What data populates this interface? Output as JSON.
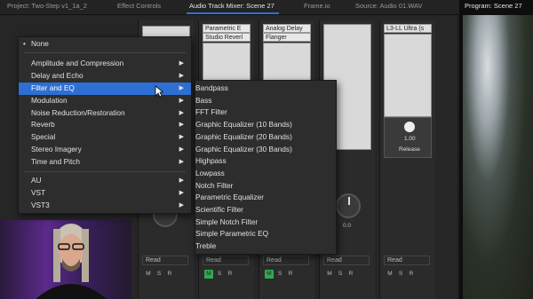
{
  "tabs": [
    {
      "label": "Project: Two-Step v1_1a_2",
      "active": false
    },
    {
      "label": "Effect Controls",
      "active": false
    },
    {
      "label": "Audio Track Mixer: Scene 27",
      "active": true
    },
    {
      "label": "Frame.io",
      "active": false
    },
    {
      "label": "Source: Audio 01.WAV",
      "active": false
    }
  ],
  "program": {
    "title": "Program: Scene 27"
  },
  "mixer": {
    "strips": [
      {
        "effect": "Parametric E",
        "effect2": "Studio Reverl"
      },
      {
        "effect": "Analog Delay",
        "effect2": "Flanger"
      },
      {
        "effect": ""
      },
      {
        "effect": "L3-LL Ultra (s"
      }
    ],
    "volume_readout": "1.00",
    "release_label": "Release",
    "pan_value": "0.0",
    "mode_label": "Read",
    "track_label": "usrite",
    "m_label": "M",
    "s_label": "S",
    "r_label": "R",
    "db_label": "dB"
  },
  "main_menu": {
    "items": [
      {
        "label": "None",
        "bullet": true
      },
      {
        "label": "Amplitude and Compression",
        "submenu": true
      },
      {
        "label": "Delay and Echo",
        "submenu": true
      },
      {
        "label": "Filter and EQ",
        "submenu": true,
        "highlighted": true
      },
      {
        "label": "Modulation",
        "submenu": true
      },
      {
        "label": "Noise Reduction/Restoration",
        "submenu": true
      },
      {
        "label": "Reverb",
        "submenu": true
      },
      {
        "label": "Special",
        "submenu": true
      },
      {
        "label": "Stereo Imagery",
        "submenu": true
      },
      {
        "label": "Time and Pitch",
        "submenu": true
      },
      {
        "label": "AU",
        "submenu": true
      },
      {
        "label": "VST",
        "submenu": true
      },
      {
        "label": "VST3",
        "submenu": true
      }
    ]
  },
  "submenu": {
    "items": [
      "Bandpass",
      "Bass",
      "FFT Filter",
      "Graphic Equalizer (10 Bands)",
      "Graphic Equalizer (20 Bands)",
      "Graphic Equalizer (30 Bands)",
      "Highpass",
      "Lowpass",
      "Notch Filter",
      "Parametric Equalizer",
      "Scientific Filter",
      "Simple Notch Filter",
      "Simple Parametric EQ",
      "Treble"
    ]
  },
  "colors": {
    "highlight": "#2e6fd3",
    "solo_on": "#34a853",
    "active_tab": "#2f6fd6"
  }
}
